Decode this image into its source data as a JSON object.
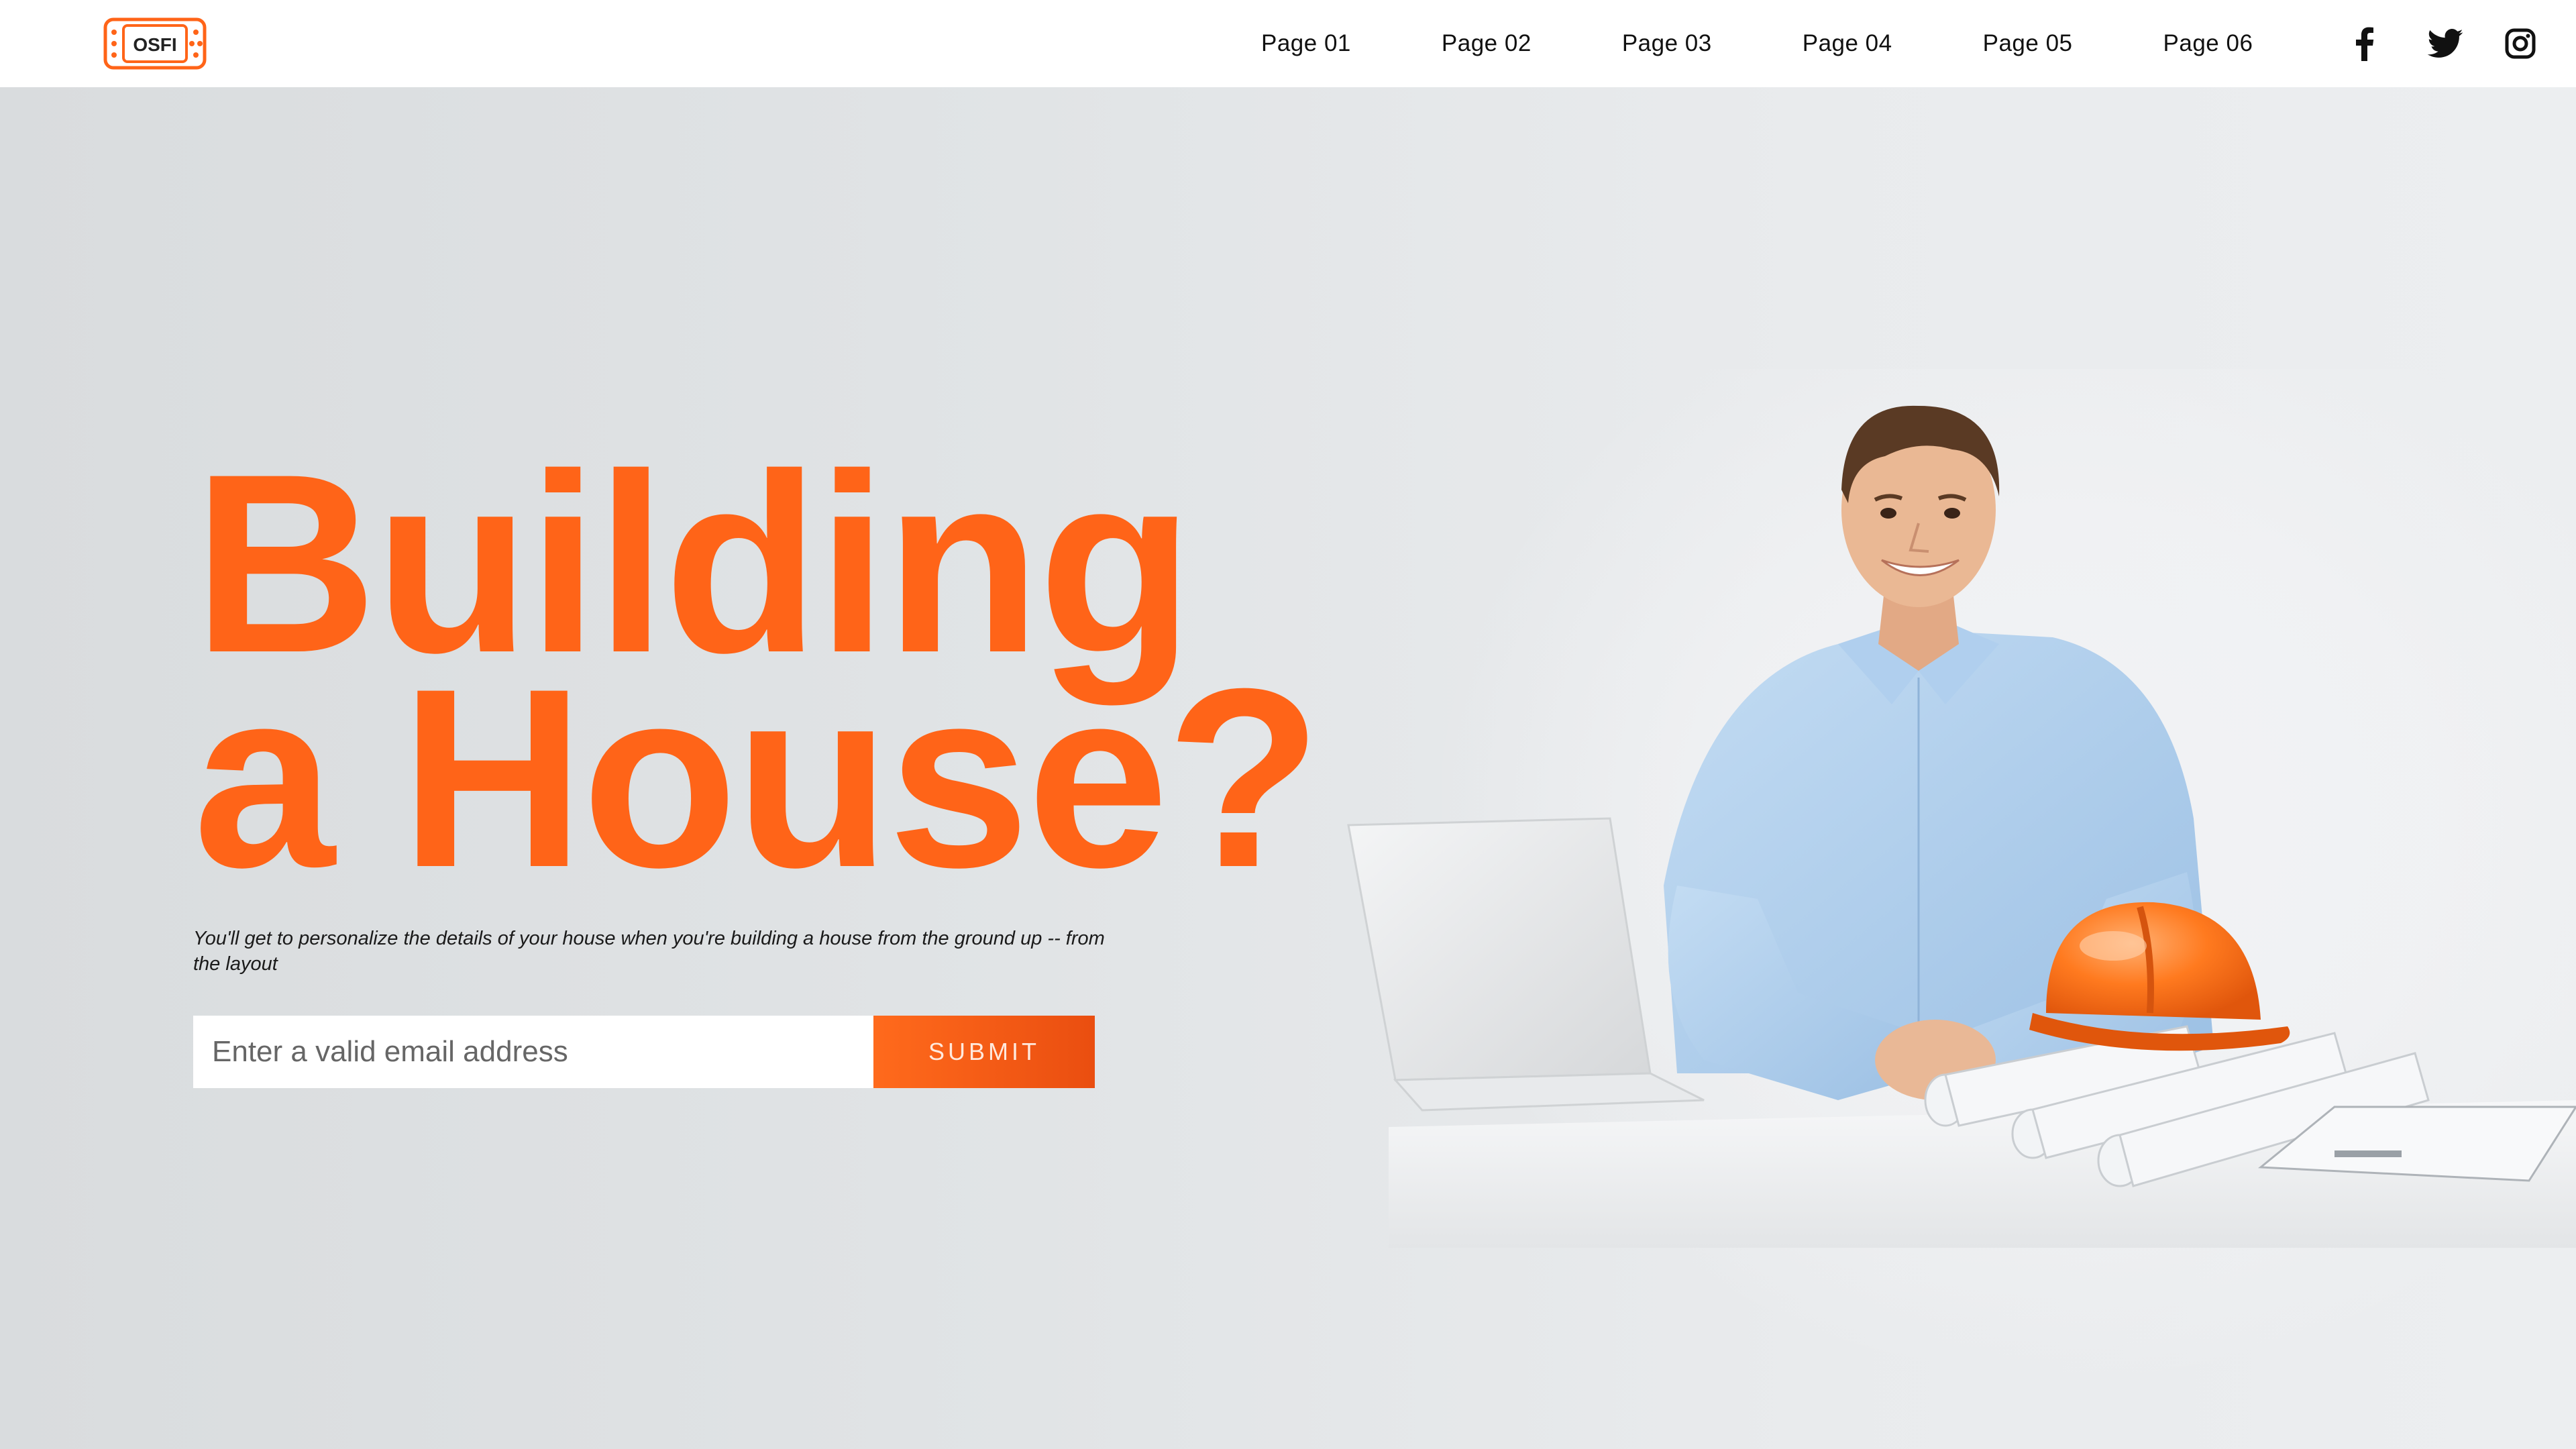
{
  "brand": {
    "logo_text": "OSFI",
    "accent": "#ff6418"
  },
  "nav": {
    "links": [
      "Page 01",
      "Page 02",
      "Page 03",
      "Page 04",
      "Page 05",
      "Page 06"
    ],
    "social": [
      "facebook-icon",
      "twitter-icon",
      "instagram-icon"
    ]
  },
  "hero": {
    "headline_line1": "Building",
    "headline_line2": "a House?",
    "subtext": "You'll get to personalize the details of your house when you're building a house from the ground up -- from the layout",
    "email_placeholder": "Enter a valid email address",
    "submit_label": "SUBMIT"
  }
}
